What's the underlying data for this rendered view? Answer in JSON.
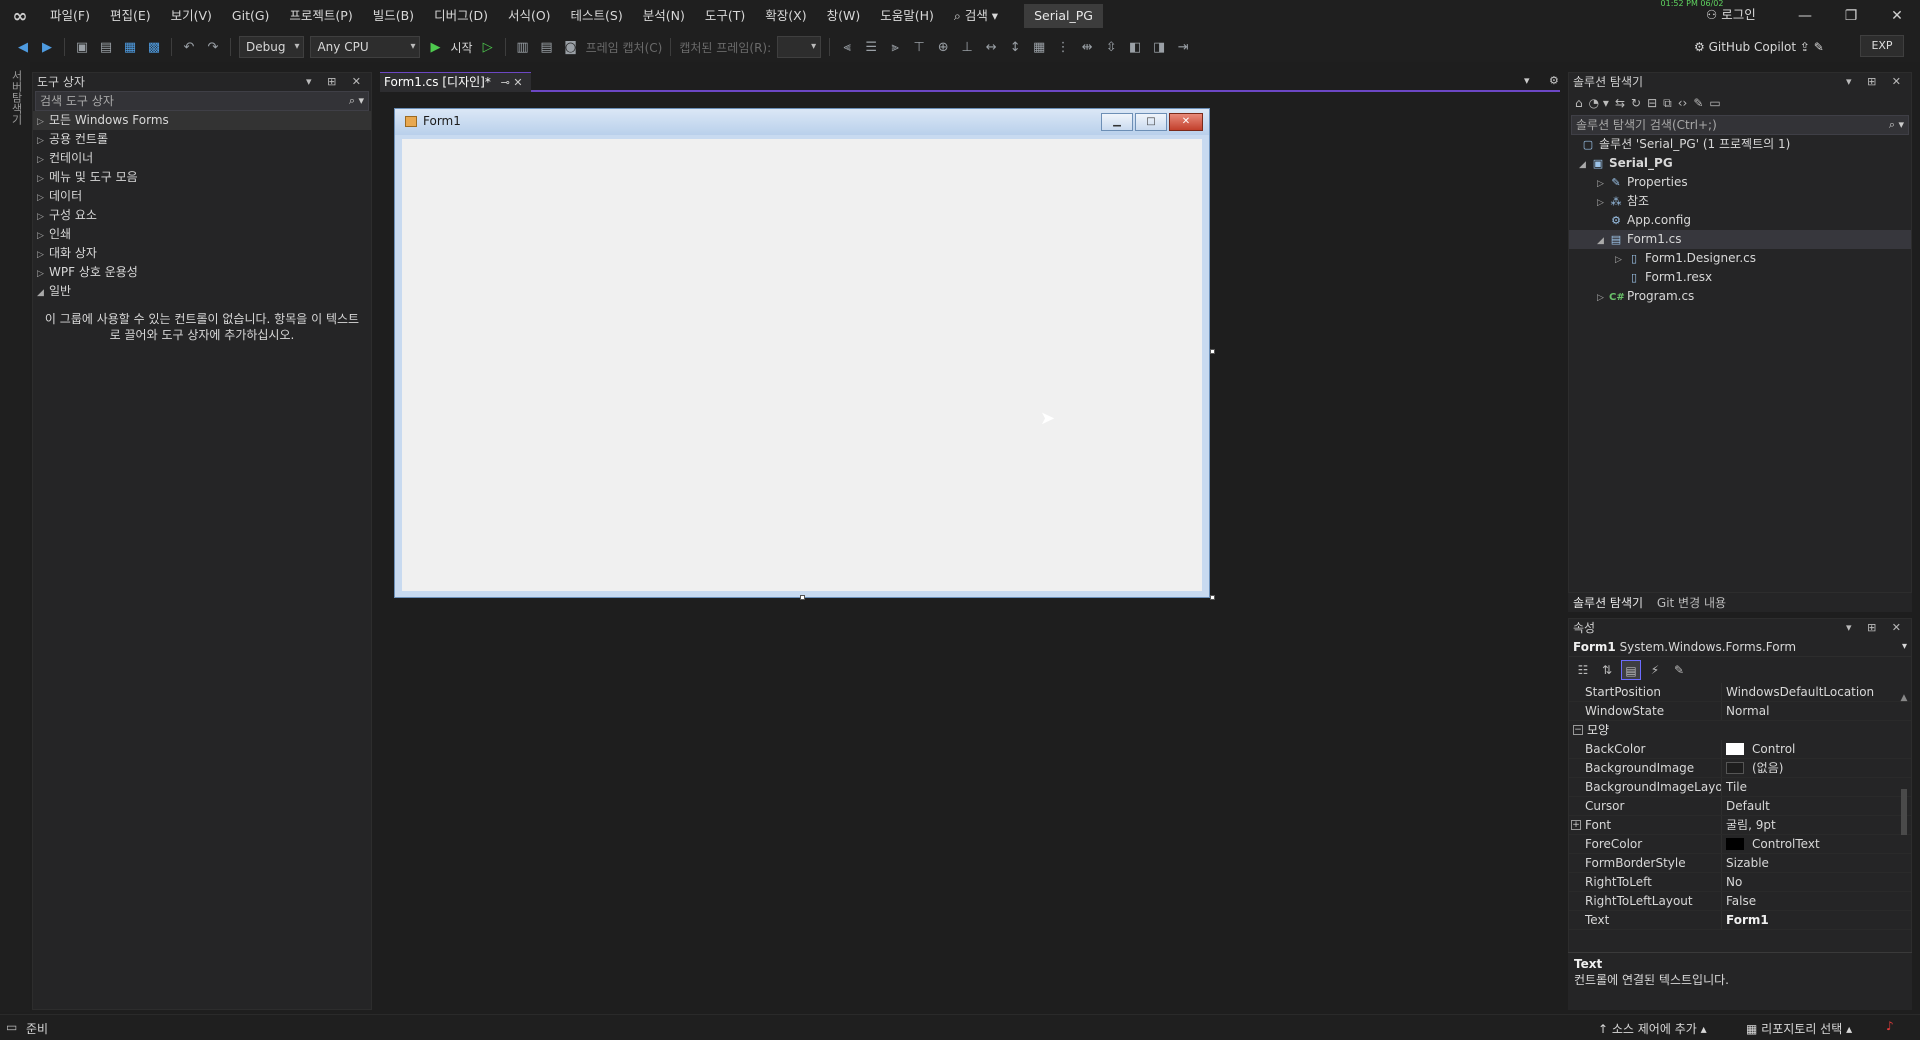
{
  "menubar": {
    "items": [
      "파일(F)",
      "편집(E)",
      "보기(V)",
      "Git(G)",
      "프로젝트(P)",
      "빌드(B)",
      "디버그(D)",
      "서식(O)",
      "테스트(S)",
      "분석(N)",
      "도구(T)",
      "확장(X)",
      "창(W)",
      "도움말(H)"
    ],
    "search": "⌕ 검색 ▾",
    "solution_name": "Serial_PG",
    "clock": "01:52 PM 06/02",
    "login": "로그인"
  },
  "toolbar": {
    "config": "Debug",
    "platform": "Any CPU",
    "start": "시작",
    "frame_capture": "프레임 캡처(C)",
    "captured_frame": "캡처된 프레임(R):",
    "copilot": "GitHub Copilot",
    "exp": "EXP"
  },
  "left_strip": {
    "label": "서버탐색기"
  },
  "toolbox": {
    "title": "도구 상자",
    "search_placeholder": "검색 도구 상자",
    "groups": [
      "모든 Windows Forms",
      "공용 컨트롤",
      "컨테이너",
      "메뉴 및 도구 모음",
      "데이터",
      "구성 요소",
      "인쇄",
      "대화 상자",
      "WPF 상호 운용성"
    ],
    "open_group": "일반",
    "empty_message": "이 그룹에 사용할 수 있는 컨트롤이 없습니다. 항목을 이 텍스트로 끌어와 도구 상자에 추가하십시오."
  },
  "document": {
    "tab_label": "Form1.cs [디자인]*",
    "form_title": "Form1"
  },
  "solution_explorer": {
    "title": "솔루션 탐색기",
    "search_placeholder": "솔루션 탐색기 검색(Ctrl+;)",
    "solution_label": "솔루션 'Serial_PG' (1 프로젝트의 1)",
    "project": "Serial_PG",
    "properties": "Properties",
    "references": "참조",
    "app_config": "App.config",
    "form1": "Form1.cs",
    "form1_designer": "Form1.Designer.cs",
    "form1_resx": "Form1.resx",
    "program": "Program.cs",
    "tab_solution": "솔루션 탐색기",
    "tab_git": "Git 변경 내용"
  },
  "properties": {
    "title": "속성",
    "object_name": "Form1",
    "object_type": "System.Windows.Forms.Form",
    "category_appearance": "모양",
    "rows": [
      {
        "name": "StartPosition",
        "value": "WindowsDefaultLocation"
      },
      {
        "name": "WindowState",
        "value": "Normal"
      }
    ],
    "appearance_rows": [
      {
        "name": "BackColor",
        "value": "Control",
        "swatch": "#ffffff"
      },
      {
        "name": "BackgroundImage",
        "value": "(없음)",
        "swatch": "#1e1e1e"
      },
      {
        "name": "BackgroundImageLayout",
        "value": "Tile"
      },
      {
        "name": "Cursor",
        "value": "Default"
      },
      {
        "name": "Font",
        "value": "굴림, 9pt"
      },
      {
        "name": "ForeColor",
        "value": "ControlText",
        "swatch": "#000000"
      },
      {
        "name": "FormBorderStyle",
        "value": "Sizable"
      },
      {
        "name": "RightToLeft",
        "value": "No"
      },
      {
        "name": "RightToLeftLayout",
        "value": "False"
      },
      {
        "name": "Text",
        "value": "Form1"
      }
    ],
    "desc_title": "Text",
    "desc_body": "컨트롤에 연결된 텍스트입니다."
  },
  "statusbar": {
    "ready": "준비",
    "source_control": "소스 제어에 추가 ▴",
    "repo_select": "리포지토리 선택 ▴"
  }
}
